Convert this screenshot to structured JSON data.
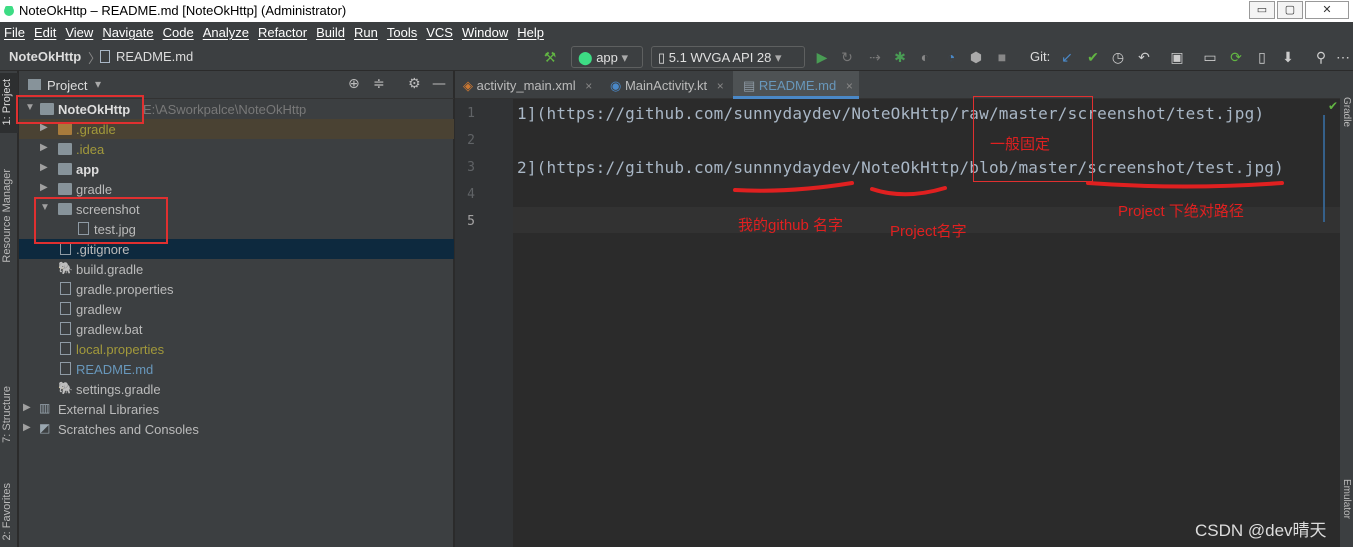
{
  "window": {
    "title": "NoteOkHttp – README.md [NoteOkHttp] (Administrator)",
    "buttons": {
      "minimize": "▭",
      "maximize": "▢",
      "close": "✕"
    }
  },
  "menu": [
    "File",
    "Edit",
    "View",
    "Navigate",
    "Code",
    "Analyze",
    "Refactor",
    "Build",
    "Run",
    "Tools",
    "VCS",
    "Window",
    "Help"
  ],
  "nav": {
    "project": "NoteOkHttp",
    "separator": "〉",
    "file": "README.md",
    "run_config": "app",
    "device": "5.1  WVGA API 28",
    "git_label": "Git:"
  },
  "left_tabs": {
    "project": "1: Project",
    "resource_manager": "Resource Manager",
    "structure": "7: Structure",
    "favorites": "2: Favorites"
  },
  "right_tabs": {
    "gradle": "Gradle",
    "emulator": "Emulator"
  },
  "project_panel": {
    "title": "Project",
    "root": {
      "name": "NoteOkHttp",
      "path": "E:\\ASworkpalce\\NoteOkHttp"
    },
    "items": [
      {
        "label": ".gradle"
      },
      {
        "label": ".idea"
      },
      {
        "label": "app"
      },
      {
        "label": "gradle"
      },
      {
        "label": "screenshot"
      },
      {
        "label": "test.jpg"
      },
      {
        "label": ".gitignore"
      },
      {
        "label": "build.gradle"
      },
      {
        "label": "gradle.properties"
      },
      {
        "label": "gradlew"
      },
      {
        "label": "gradlew.bat"
      },
      {
        "label": "local.properties"
      },
      {
        "label": "README.md"
      },
      {
        "label": "settings.gradle"
      },
      {
        "label": "External Libraries"
      },
      {
        "label": "Scratches and Consoles"
      }
    ]
  },
  "tabs": [
    {
      "label": "activity_main.xml",
      "close": "×"
    },
    {
      "label": "MainActivity.kt",
      "close": "×"
    },
    {
      "label": "README.md",
      "close": "×"
    }
  ],
  "editor": {
    "line_numbers": [
      "1",
      "2",
      "3",
      "4",
      "5"
    ],
    "lines": [
      "1](https://github.com/sunnydaydev/NoteOkHttp/raw/master/screenshot/test.jpg)",
      "",
      "2](https://github.com/sunnnydaydev/NoteOkHttp/blob/master/screenshot/test.jpg)",
      "",
      ""
    ]
  },
  "annotations": {
    "fixed_label": "一般固定",
    "github_name": "我的github 名字",
    "project_name": "Project名字",
    "relative_path": "Project 下绝对路径"
  },
  "watermark": "CSDN @dev晴天",
  "colors": {
    "accent_blue": "#4a88c7",
    "annotation_red": "#e02020",
    "run_green": "#499c54",
    "build_hammer": "#62b543"
  }
}
